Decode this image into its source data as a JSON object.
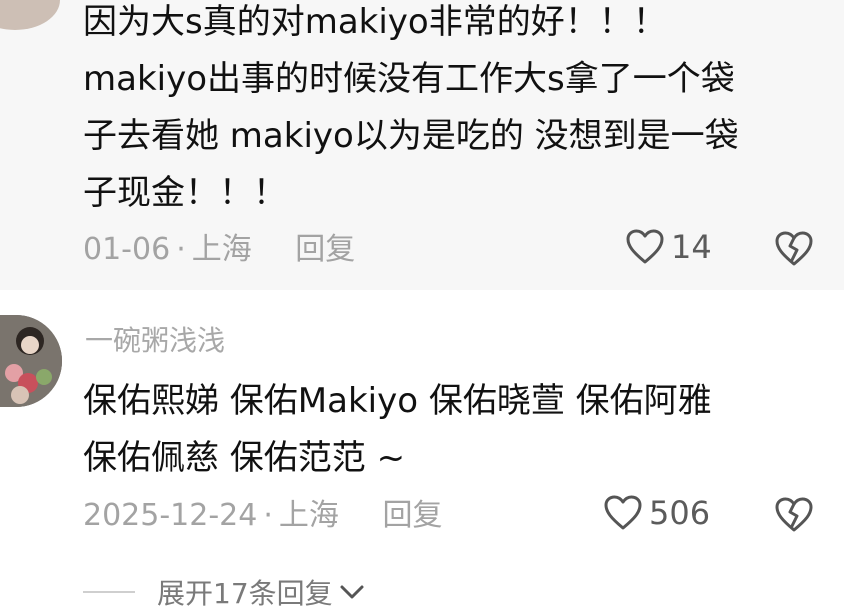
{
  "comments": [
    {
      "lines": [
        "因为大s真的对makiyo非常的好！！！",
        "makiyo出事的时候没有工作大s拿了一个袋",
        "子去看她 makiyo以为是吃的 没想到是一袋",
        "子现金！！！"
      ],
      "date": "01-06",
      "location": "上海",
      "reply_label": "回复",
      "likes": "14"
    },
    {
      "username": "一碗粥浅浅",
      "lines": [
        "保佑熙娣 保佑Makiyo 保佑晓萱 保佑阿雅",
        "保佑佩慈 保佑范范 ~"
      ],
      "date": "2025-12-24",
      "location": "上海",
      "reply_label": "回复",
      "likes": "506"
    }
  ],
  "expand_label": "展开17条回复",
  "icons": {
    "like": "heart-outline-icon",
    "dislike": "broken-heart-icon",
    "expand": "chevron-down-icon"
  },
  "colors": {
    "text": "#111111",
    "meta": "#a3a3a3",
    "highlight_bg": "#f7f7f7"
  }
}
